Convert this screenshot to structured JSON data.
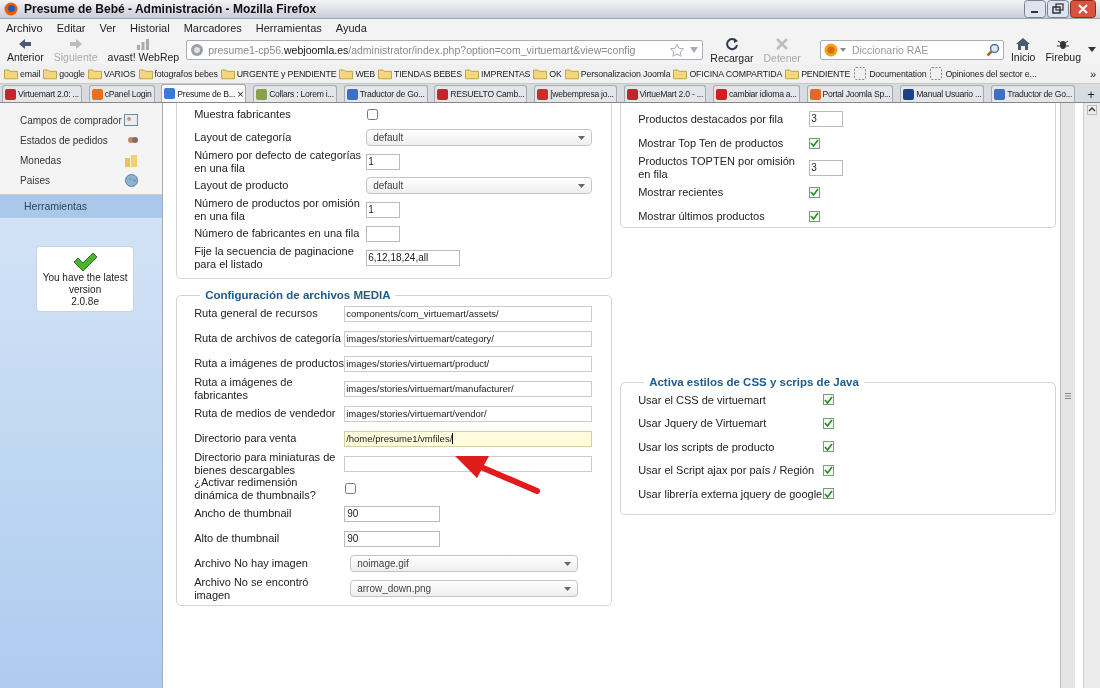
{
  "window": {
    "title": "Presume de Bebé - Administración - Mozilla Firefox"
  },
  "menu": [
    "Archivo",
    "Editar",
    "Ver",
    "Historial",
    "Marcadores",
    "Herramientas",
    "Ayuda"
  ],
  "navigation": [
    {
      "label": "Anterior",
      "kind": "back",
      "disabled": false
    },
    {
      "label": "Siguiente",
      "kind": "forward",
      "disabled": true
    },
    {
      "label": "avast! WebRep",
      "kind": "rep",
      "disabled": false
    }
  ],
  "address": {
    "before": "presume1-cp56.",
    "host": "webjoomla.es",
    "after": "/administrator/index.php?option=com_virtuemart&view=config"
  },
  "actions": [
    {
      "label": "Recargar",
      "kind": "reload",
      "disabled": false
    },
    {
      "label": "Detener",
      "kind": "stop",
      "disabled": true
    }
  ],
  "search": {
    "placeholder": "Diccionario RAE"
  },
  "end_actions": [
    {
      "label": "Inicio",
      "kind": "home"
    },
    {
      "label": "Firebug",
      "kind": "bug"
    }
  ],
  "bookmarks": [
    {
      "label": "email",
      "kind": "folder"
    },
    {
      "label": "google",
      "kind": "folder"
    },
    {
      "label": "VARIOS",
      "kind": "folder"
    },
    {
      "label": "fotografos bebes",
      "kind": "folder"
    },
    {
      "label": "URGENTE y PENDIENTE",
      "kind": "folder"
    },
    {
      "label": "WEB",
      "kind": "folder"
    },
    {
      "label": "TIENDAS BEBES",
      "kind": "folder"
    },
    {
      "label": "IMPRENTAS",
      "kind": "folder"
    },
    {
      "label": "OK",
      "kind": "folder"
    },
    {
      "label": "Personalizacion Joomla",
      "kind": "folder"
    },
    {
      "label": "OFICINA COMPARTIDA",
      "kind": "folder"
    },
    {
      "label": "PENDIENTE",
      "kind": "folder"
    },
    {
      "label": "Documentation",
      "kind": "page"
    },
    {
      "label": "Opiniones del sector e...",
      "kind": "page"
    }
  ],
  "bookmarks_more": "»",
  "tabs": [
    {
      "label": "Virtuemart 2.0: ...",
      "selected": false,
      "color": "#c0262c"
    },
    {
      "label": "cPanel Login",
      "selected": false,
      "color": "#e8701a"
    },
    {
      "label": "Presume de B...",
      "selected": true,
      "color": "#3a7bd5"
    },
    {
      "label": "Collars : Lorem i...",
      "selected": false,
      "color": "#8aa04a"
    },
    {
      "label": "Traductor de Go...",
      "selected": false,
      "color": "#3b6fc4"
    },
    {
      "label": "RESUELTO Camb...",
      "selected": false,
      "color": "#c0262c"
    },
    {
      "label": "[webempresa jo...",
      "selected": false,
      "color": "#c8302a"
    },
    {
      "label": "VirtueMart 2.0 - ...",
      "selected": false,
      "color": "#c0262c"
    },
    {
      "label": "cambiar idioma a...",
      "selected": false,
      "color": "#d21f1f"
    },
    {
      "label": "Portal Joomla Sp...",
      "selected": false,
      "color": "#e06a2a"
    },
    {
      "label": "Manual Usuario ...",
      "selected": false,
      "color": "#1d3f8c"
    },
    {
      "label": "Traductor de Go...",
      "selected": false,
      "color": "#3b6fc4"
    }
  ],
  "tab_close": "×",
  "new_tab": "+",
  "sidebar": {
    "items": [
      {
        "label": "Campos de comprador",
        "kind": "card"
      },
      {
        "label": "Estados de pedidos",
        "kind": "dots"
      },
      {
        "label": "Monedas",
        "kind": "coins"
      },
      {
        "label": "Paises",
        "kind": "globe"
      }
    ],
    "section": {
      "label": "Herramientas",
      "selected": true
    },
    "version": {
      "message": "You have the latest version",
      "number": "2.0.8e"
    }
  },
  "left_panel": {
    "rows": [
      {
        "label": "Muestra fabricantes",
        "kind": "checkbox",
        "checked": false
      },
      {
        "label": "Layout de categoría",
        "kind": "select",
        "value": "default"
      },
      {
        "label": "Número por defecto de categorías en una fila",
        "kind": "text",
        "value": "1"
      },
      {
        "label": "Layout de producto",
        "kind": "select",
        "value": "default"
      },
      {
        "label": "Número de productos por omisión en una fila",
        "kind": "text",
        "value": "1"
      },
      {
        "label": "Número de fabricantes en una fila",
        "kind": "text"
      },
      {
        "label": "Fije la secuencia de paginacione para el listado",
        "kind": "list",
        "value": "6,12,18,24,all"
      }
    ]
  },
  "media": {
    "legend": "Configuración de archivos MEDIA",
    "rows": [
      {
        "label": "Ruta general de recursos",
        "kind": "path",
        "value": "components/com_virtuemart/assets/"
      },
      {
        "label": "Ruta de archivos de categoría",
        "kind": "path",
        "value": "images/stories/virtuemart/category/"
      },
      {
        "label": "Ruta a imágenes de productos",
        "kind": "path",
        "value": "images/stories/virtuemart/product/"
      },
      {
        "label": "Ruta a imágenes de fabricantes",
        "kind": "path",
        "value": "images/stories/virtuemart/manufacturer/"
      },
      {
        "label": "Ruta de medios de vendedor",
        "kind": "path",
        "value": "images/stories/virtuemart/vendor/"
      },
      {
        "label": "Directorio para venta",
        "kind": "path",
        "value": "/home/presume1/vmfiles/",
        "focused": true
      },
      {
        "label": "Directorio para miniaturas de bienes descargables",
        "kind": "path"
      },
      {
        "label": "¿Activar redimensión dinámica de thumbnails?",
        "kind": "checkbox",
        "checked": false
      },
      {
        "label": "Ancho de thumbnail",
        "kind": "number",
        "value": "90"
      },
      {
        "label": "Alto de thumbnail",
        "kind": "number",
        "value": "90"
      },
      {
        "label": "Archivo No hay imagen",
        "kind": "select",
        "value": "noimage.gif"
      },
      {
        "label": "Archivo No se encontró imagen",
        "kind": "select",
        "value": "arrow_down.png"
      }
    ]
  },
  "right_panel": {
    "rows": [
      {
        "label": "Productos destacados por fila",
        "kind": "text",
        "value": "3"
      },
      {
        "label": "Mostrar Top Ten de productos",
        "kind": "checkbox",
        "checked": true
      },
      {
        "label": "Productos TOPTEN por omisión en fila",
        "kind": "text",
        "value": "3"
      },
      {
        "label": "Mostrar recientes",
        "kind": "checkbox",
        "checked": true
      },
      {
        "label": "Mostrar últimos productos",
        "kind": "checkbox",
        "checked": true
      }
    ]
  },
  "css_js": {
    "legend": "Activa estilos de CSS y scrips de Java",
    "rows": [
      {
        "label": "Usar el CSS de virtuemart",
        "kind": "checkbox",
        "checked": true
      },
      {
        "label": "Usar Jquery de Virtuemart",
        "kind": "checkbox",
        "checked": true
      },
      {
        "label": "Usar los scripts de producto",
        "kind": "checkbox",
        "checked": true
      },
      {
        "label": "Usar el Script ajax por país / Región",
        "kind": "checkbox",
        "checked": true
      },
      {
        "label": "Usar librería externa jquery de google",
        "kind": "checkbox",
        "checked": true
      }
    ]
  }
}
